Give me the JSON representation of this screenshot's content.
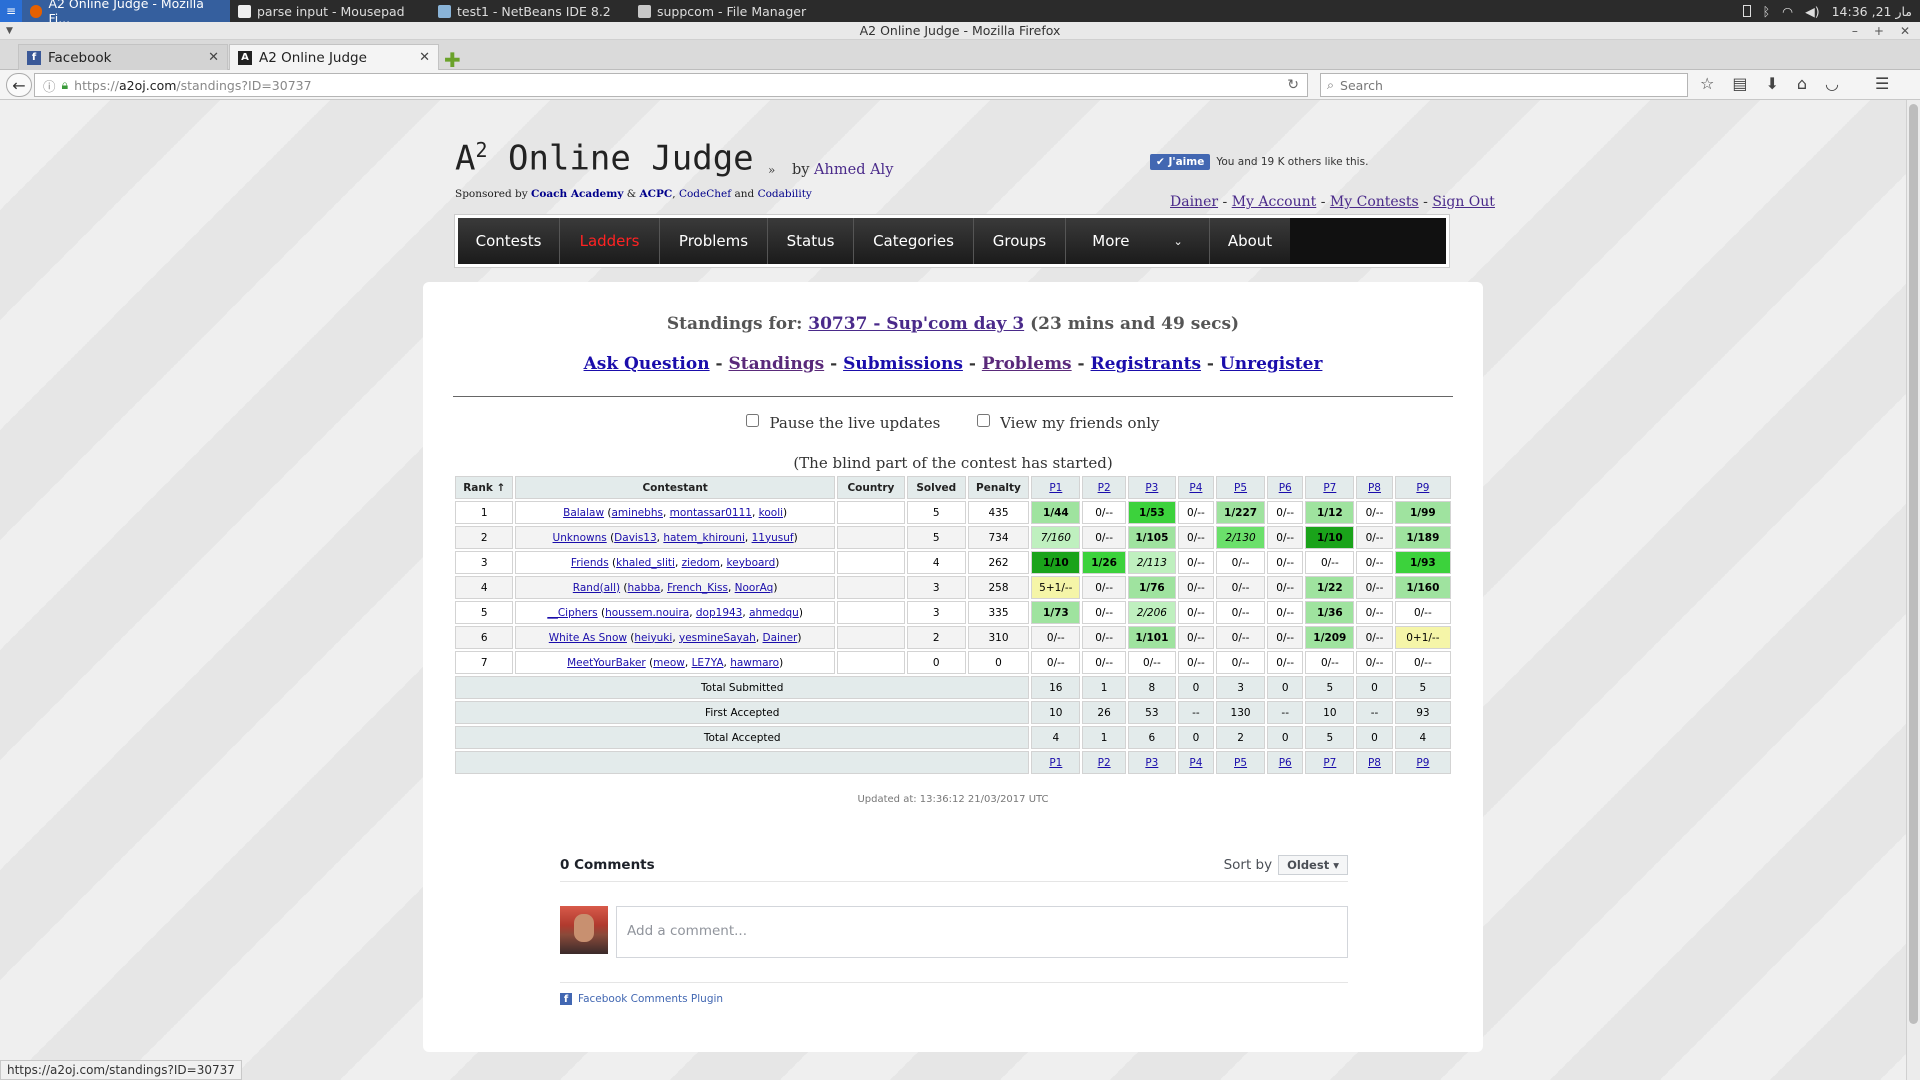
{
  "taskbar": {
    "tasks": [
      {
        "label": "A2 Online Judge - Mozilla Fi...",
        "active": true
      },
      {
        "label": "parse input - Mousepad",
        "active": false
      },
      {
        "label": "test1 - NetBeans IDE 8.2",
        "active": false
      },
      {
        "label": "suppcom - File Manager",
        "active": false
      }
    ],
    "clock": "14:36 ,21 مار"
  },
  "window": {
    "title": "A2 Online Judge - Mozilla Firefox"
  },
  "tabs": [
    {
      "label": "Facebook"
    },
    {
      "label": "A2 Online Judge"
    }
  ],
  "nav": {
    "url_prefix": "https://",
    "url_host": "a2oj.com",
    "url_path": "/standings?ID=30737",
    "search_placeholder": "Search"
  },
  "site": {
    "brand": "A",
    "brand_sup": "2",
    "brand_rest": " Online Judge",
    "brand_arrow": "»",
    "by": "by",
    "author": "Ahmed Aly",
    "sponsored_by": "Sponsored by",
    "sponsors": [
      "Coach Academy",
      "ACPC",
      "CodeChef",
      "Codability"
    ],
    "amp": "&",
    "and": "and",
    "like_button": "J'aime",
    "like_text": "You and 19 K others like this.",
    "user_links": [
      "Dainer",
      "My Account",
      "My Contests",
      "Sign Out"
    ],
    "menu": [
      "Contests",
      "Ladders",
      "Problems",
      "Status",
      "Categories",
      "Groups",
      "More",
      "About"
    ]
  },
  "standings": {
    "title_prefix": "Standings for:",
    "contest_link": "30737 - Sup'com day 3",
    "elapsed": "(23 mins and 49 secs)",
    "links": [
      "Ask Question",
      "Standings",
      "Submissions",
      "Problems",
      "Registrants",
      "Unregister"
    ],
    "options": [
      "Pause the live updates",
      "View my friends only"
    ],
    "blind_note": "(The blind part of the contest has started)",
    "headers": [
      "Rank ↑",
      "Contestant",
      "Country",
      "Solved",
      "Penalty"
    ],
    "problems": [
      "P1",
      "P2",
      "P3",
      "P4",
      "P5",
      "P6",
      "P7",
      "P8",
      "P9"
    ],
    "rows": [
      {
        "rank": "1",
        "team": "Balalaw",
        "members": [
          "aminebhs",
          "montassar0111",
          "kooli"
        ],
        "solved": "5",
        "penalty": "435",
        "cells": [
          "1/44",
          "0/--",
          "1/53",
          "0/--",
          "1/227",
          "0/--",
          "1/12",
          "0/--",
          "1/99"
        ],
        "cls": [
          "c-ok",
          "",
          "c-first",
          "",
          "c-ok",
          "",
          "c-ok",
          "",
          "c-ok"
        ]
      },
      {
        "rank": "2",
        "team": "Unknowns",
        "members": [
          "Davis13",
          "hatem_khirouni",
          "11yusuf"
        ],
        "solved": "5",
        "penalty": "734",
        "cells": [
          "7/160",
          "0/--",
          "1/105",
          "0/--",
          "2/130",
          "0/--",
          "1/10",
          "0/--",
          "1/189"
        ],
        "cls": [
          "c-ital",
          "",
          "c-ok",
          "",
          "c-ital2",
          "",
          "c-best",
          "",
          "c-ok"
        ]
      },
      {
        "rank": "3",
        "team": "Friends",
        "members": [
          "khaled_sliti",
          "ziedom",
          "keyboard"
        ],
        "solved": "4",
        "penalty": "262",
        "cells": [
          "1/10",
          "1/26",
          "2/113",
          "0/--",
          "0/--",
          "0/--",
          "0/--",
          "0/--",
          "1/93"
        ],
        "cls": [
          "c-best",
          "c-first",
          "c-ital",
          "",
          "",
          "",
          "",
          "",
          "c-first"
        ]
      },
      {
        "rank": "4",
        "team": "Rand(all)",
        "members": [
          "habba",
          "French_Kiss",
          "NoorAq"
        ],
        "solved": "3",
        "penalty": "258",
        "cells": [
          "5+1/--",
          "0/--",
          "1/76",
          "0/--",
          "0/--",
          "0/--",
          "1/22",
          "0/--",
          "1/160"
        ],
        "cls": [
          "c-pend",
          "",
          "c-ok",
          "",
          "",
          "",
          "c-ok",
          "",
          "c-ok"
        ]
      },
      {
        "rank": "5",
        "team": "__Ciphers",
        "members": [
          "houssem.nouira",
          "dop1943",
          "ahmedqu"
        ],
        "solved": "3",
        "penalty": "335",
        "cells": [
          "1/73",
          "0/--",
          "2/206",
          "0/--",
          "0/--",
          "0/--",
          "1/36",
          "0/--",
          "0/--"
        ],
        "cls": [
          "c-ok",
          "",
          "c-ital",
          "",
          "",
          "",
          "c-ok",
          "",
          ""
        ]
      },
      {
        "rank": "6",
        "team": "White As Snow",
        "members": [
          "heiyuki",
          "yesmineSayah",
          "Dainer"
        ],
        "solved": "2",
        "penalty": "310",
        "cells": [
          "0/--",
          "0/--",
          "1/101",
          "0/--",
          "0/--",
          "0/--",
          "1/209",
          "0/--",
          "0+1/--"
        ],
        "cls": [
          "",
          "",
          "c-ok",
          "",
          "",
          "",
          "c-ok",
          "",
          "c-pend"
        ]
      },
      {
        "rank": "7",
        "team": "MeetYourBaker",
        "members": [
          "meow",
          "LE7YA",
          "hawmaro"
        ],
        "solved": "0",
        "penalty": "0",
        "cells": [
          "0/--",
          "0/--",
          "0/--",
          "0/--",
          "0/--",
          "0/--",
          "0/--",
          "0/--",
          "0/--"
        ],
        "cls": [
          "",
          "",
          "",
          "",
          "",
          "",
          "",
          "",
          ""
        ]
      }
    ],
    "summary": [
      {
        "label": "Total Submitted",
        "values": [
          "16",
          "1",
          "8",
          "0",
          "3",
          "0",
          "5",
          "0",
          "5"
        ]
      },
      {
        "label": "First Accepted",
        "values": [
          "10",
          "26",
          "53",
          "--",
          "130",
          "--",
          "10",
          "--",
          "93"
        ]
      },
      {
        "label": "Total Accepted",
        "values": [
          "4",
          "1",
          "6",
          "0",
          "2",
          "0",
          "5",
          "0",
          "4"
        ]
      }
    ],
    "updated": "Updated at: 13:36:12 21/03/2017 UTC"
  },
  "comments": {
    "count": "0 Comments",
    "sort_by": "Sort by",
    "sort_value": "Oldest",
    "placeholder": "Add a comment...",
    "plugin": "Facebook Comments Plugin"
  },
  "status_url": "https://a2oj.com/standings?ID=30737"
}
